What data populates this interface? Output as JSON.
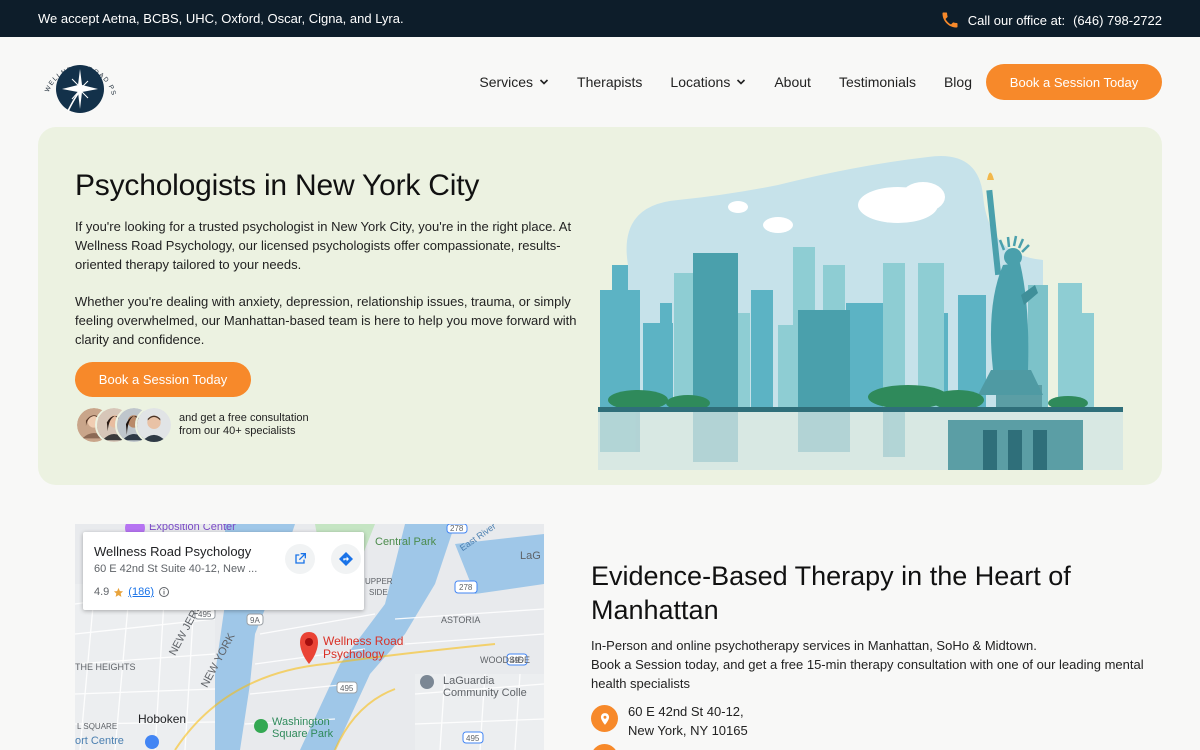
{
  "topbar": {
    "insurance_text": "We accept Aetna, BCBS, UHC, Oxford, Oscar, Cigna, and Lyra.",
    "call_label": "Call our office at:",
    "phone": "(646) 798-2722",
    "icon": "phone-icon"
  },
  "brand": {
    "logo_text": "WELLNESS ROAD PSYCHOLOGY",
    "accent_color": "#f7892a",
    "dark_color": "#0d1d2a",
    "hero_bg": "#ecf2e1"
  },
  "nav": {
    "items": [
      {
        "label": "Services",
        "has_dropdown": true
      },
      {
        "label": "Therapists",
        "has_dropdown": false
      },
      {
        "label": "Locations",
        "has_dropdown": true
      },
      {
        "label": "About",
        "has_dropdown": false
      },
      {
        "label": "Testimonials",
        "has_dropdown": false
      },
      {
        "label": "Blog",
        "has_dropdown": false
      }
    ],
    "cta_label": "Book a Session Today"
  },
  "hero": {
    "title": "Psychologists in New York City",
    "paragraph1": "If you're looking for a trusted psychologist in New York City, you're in the right place. At Wellness Road Psychology, our licensed psychologists offer compassionate, results-oriented therapy tailored to your needs.",
    "paragraph2": "Whether you're dealing with anxiety, depression, relationship issues, trauma, or simply feeling overwhelmed, our Manhattan-based team is here to help you move forward with clarity and confidence.",
    "cta_label": "Book a Session Today",
    "consult_line1": "and get a free consultation",
    "consult_line2": "from our 40+ specialists"
  },
  "map": {
    "business_name": "Wellness Road Psychology",
    "address_short": "60 E 42nd St Suite 40-12, New ...",
    "rating": "4.9",
    "review_count": "(186)",
    "pin_label_line1": "Wellness Road",
    "pin_label_line2": "Psychology",
    "labels": {
      "expo": "Exposition Center",
      "central_park": "Central Park",
      "east_river": "East River",
      "lag": "LaG",
      "upper": "UPPER",
      "side": "SIDE",
      "astoria": "ASTORIA",
      "woodside": "WOODSIDE",
      "heights": "THE HEIGHTS",
      "new_jersey": "NEW JERSEY",
      "new_york": "NEW YORK",
      "hoboken": "Hoboken",
      "laguardia_line1": "LaGuardia",
      "laguardia_line2": "Community Colle",
      "washington_line1": "Washington",
      "washington_line2": "Square Park",
      "square": "L SQUARE",
      "port": "ort Centre",
      "r495a": "495",
      "r9a": "9A",
      "r495b": "495",
      "r495c": "495",
      "r278": "278",
      "r278b": "278",
      "r495d": "495"
    }
  },
  "section2": {
    "title": "Evidence-Based Therapy in the Heart of Manhattan",
    "desc_line1": "In-Person and online psychotherapy services in Manhattan, SoHo & Midtown.",
    "desc_line2": "Book a Session today, and get a free 15-min therapy consultation with one of our leading mental health specialists",
    "address_line1": "60 E 42nd St 40-12,",
    "address_line2": "New York, NY 10165"
  }
}
